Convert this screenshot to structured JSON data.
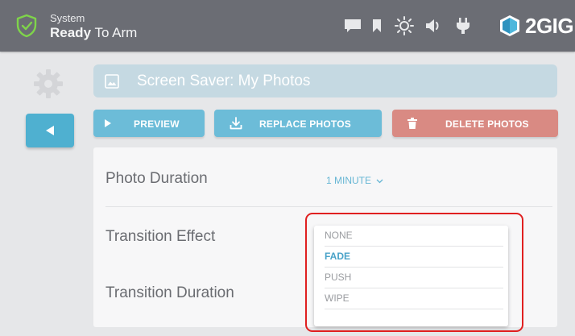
{
  "status": {
    "line1": "System",
    "line2_bold": "Ready",
    "line2_rest": " To Arm"
  },
  "brand": {
    "name": "2GIG"
  },
  "toolbar_icons": [
    "message-icon",
    "bookmark-icon",
    "brightness-icon",
    "volume-icon",
    "power-plug-icon"
  ],
  "page": {
    "title": "Screen Saver: My Photos"
  },
  "actions": {
    "preview": "PREVIEW",
    "replace_photos": "REPLACE PHOTOS",
    "delete_photos": "DELETE PHOTOS"
  },
  "settings": {
    "photo_duration": {
      "label": "Photo Duration",
      "value": "1 MINUTE"
    },
    "transition_effect": {
      "label": "Transition Effect"
    },
    "transition_duration": {
      "label": "Transition Duration"
    }
  },
  "dropdown": {
    "options": [
      "NONE",
      "FADE",
      "PUSH",
      "WIPE"
    ],
    "selected": "FADE"
  },
  "colors": {
    "topbar": "#6b6d74",
    "accent_blue": "#6cbcd8",
    "delete_red": "#d98a83",
    "highlight_red": "#e02020",
    "shield_green": "#7fd44a"
  }
}
